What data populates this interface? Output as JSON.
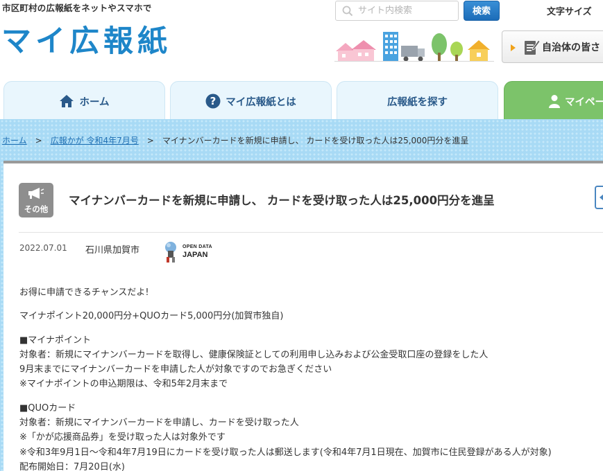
{
  "header": {
    "tagline": "市区町村の広報紙をネットやスマホで",
    "logo": "マイ広報紙",
    "search_placeholder": "サイト内検索",
    "search_button": "検索",
    "font_size_label": "文字サイズ",
    "gov_button": "自治体の皆さ"
  },
  "nav": {
    "tabs": [
      {
        "label": "ホーム",
        "icon": "home-icon"
      },
      {
        "label": "マイ広報紙とは",
        "icon": "question-icon"
      },
      {
        "label": "広報紙を探す",
        "icon": ""
      },
      {
        "label": "マイペー",
        "icon": "person-icon"
      }
    ]
  },
  "breadcrumb": {
    "home": "ホーム",
    "issue": "広報かが 令和4年7月号",
    "current": "マイナンバーカードを新規に申請し、 カードを受け取った人は25,000円分を進呈",
    "separator": ">"
  },
  "article": {
    "category": "その他",
    "title": "マイナンバーカードを新規に申請し、 カードを受け取った人は25,000円分を進呈",
    "date": "2022.07.01",
    "city": "石川県加賀市",
    "badge_line1": "OPEN DATA",
    "badge_line2": "JAPAN",
    "paragraphs": [
      [
        "お得に申請できるチャンスだよ!"
      ],
      [
        "マイナポイント20,000円分+QUOカード5,000円分(加賀市独自)"
      ],
      [
        "■マイナポイント",
        "対象者：新規にマイナンバーカードを取得し、健康保険証としての利用申し込みおよび公金受取口座の登録をした人",
        "9月末までにマイナンバーカードを申請した人が対象ですのでお急ぎください",
        "※マイナポイントの申込期限は、令和5年2月末まで"
      ],
      [
        "■QUOカード",
        "対象者：新規にマイナンバーカードを申請し、カードを受け取った人",
        "※「かが応援商品券」を受け取った人は対象外です",
        "※令和3年9月1日～令和4年7月19日にカードを受け取った人は郵送します(令和4年7月1日現在、加賀市に住民登録がある人が対象)",
        "配布開始日：7月20日(水)"
      ]
    ]
  },
  "colors": {
    "logo": "#1e86c9",
    "band": "#a8daf5",
    "tab": "#e9f6fd",
    "mypage_tab": "#7cc36a",
    "search_button": "#1c6cb8",
    "category_badge": "#8e8e8e"
  }
}
